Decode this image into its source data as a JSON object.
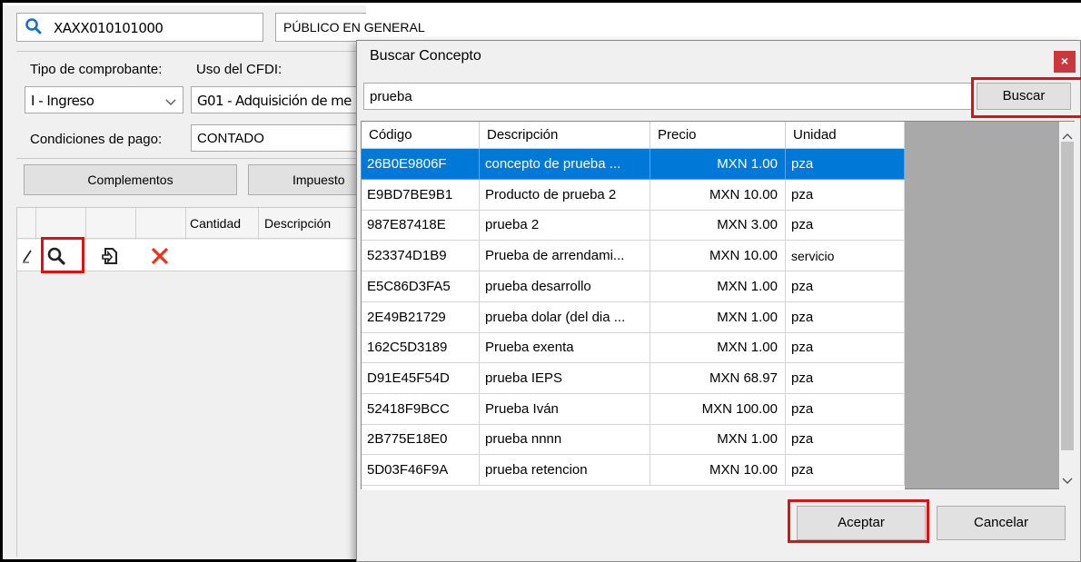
{
  "main": {
    "rfc_value": "XAXX010101000",
    "client_name": "PÚBLICO EN GENERAL",
    "tipo_label": "Tipo de comprobante:",
    "tipo_value": "I - Ingreso",
    "uso_label": "Uso del CFDI:",
    "uso_value": "G01 - Adquisición de me",
    "condiciones_label": "Condiciones de pago:",
    "condiciones_value": "CONTADO",
    "complementos_label": "Complementos",
    "impuestos_label": "Impuesto",
    "grid_headers": [
      "Cantidad",
      "Descripción"
    ]
  },
  "dialog": {
    "title": "Buscar Concepto",
    "close_glyph": "×",
    "search_value": "prueba",
    "search_button": "Buscar",
    "columns": [
      "Código",
      "Descripción",
      "Precio",
      "Unidad"
    ],
    "rows": [
      {
        "codigo": "26B0E9806F",
        "descripcion": "concepto de prueba ...",
        "precio": "MXN 1.00",
        "unidad": "pza"
      },
      {
        "codigo": "E9BD7BE9B1",
        "descripcion": "Producto de prueba 2",
        "precio": "MXN 10.00",
        "unidad": "pza"
      },
      {
        "codigo": "987E87418E",
        "descripcion": "prueba 2",
        "precio": "MXN 3.00",
        "unidad": "pza"
      },
      {
        "codigo": "523374D1B9",
        "descripcion": "Prueba de arrendami...",
        "precio": "MXN 10.00",
        "unidad": "servicio"
      },
      {
        "codigo": "E5C86D3FA5",
        "descripcion": "prueba desarrollo",
        "precio": "MXN 1.00",
        "unidad": "pza"
      },
      {
        "codigo": "2E49B21729",
        "descripcion": "prueba dolar (del dia ...",
        "precio": "MXN 1.00",
        "unidad": "pza"
      },
      {
        "codigo": "162C5D3189",
        "descripcion": "Prueba exenta",
        "precio": "MXN 1.00",
        "unidad": "pza"
      },
      {
        "codigo": "D91E45F54D",
        "descripcion": "prueba IEPS",
        "precio": "MXN 68.97",
        "unidad": "pza"
      },
      {
        "codigo": "52418F9BCC",
        "descripcion": "Prueba Iván",
        "precio": "MXN 100.00",
        "unidad": "pza"
      },
      {
        "codigo": "2B775E18E0",
        "descripcion": "prueba nnnn",
        "precio": "MXN 1.00",
        "unidad": "pza"
      },
      {
        "codigo": "5D03F46F9A",
        "descripcion": "prueba retencion",
        "precio": "MXN 10.00",
        "unidad": "pza"
      }
    ],
    "accept_button": "Aceptar",
    "cancel_button": "Cancelar"
  },
  "colors": {
    "selection": "#0078d7",
    "highlight": "#e01010",
    "delete_icon": "#e8341c",
    "search_icon": "#1a6fc9"
  }
}
